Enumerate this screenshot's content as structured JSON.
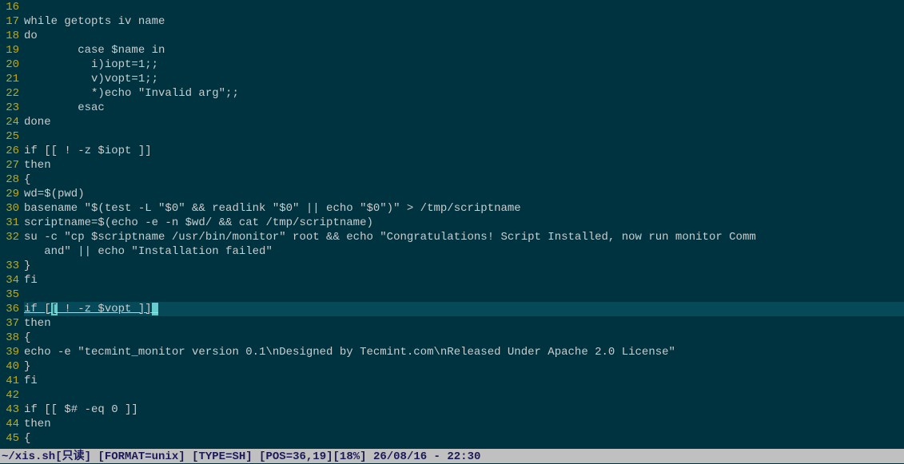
{
  "editor": {
    "lines": [
      {
        "num": 16,
        "text": ""
      },
      {
        "num": 17,
        "text": "while getopts iv name"
      },
      {
        "num": 18,
        "text": "do"
      },
      {
        "num": 19,
        "text": "        case $name in"
      },
      {
        "num": 20,
        "text": "          i)iopt=1;;"
      },
      {
        "num": 21,
        "text": "          v)vopt=1;;"
      },
      {
        "num": 22,
        "text": "          *)echo \"Invalid arg\";;"
      },
      {
        "num": 23,
        "text": "        esac"
      },
      {
        "num": 24,
        "text": "done"
      },
      {
        "num": 25,
        "text": ""
      },
      {
        "num": 26,
        "text": "if [[ ! -z $iopt ]]"
      },
      {
        "num": 27,
        "text": "then"
      },
      {
        "num": 28,
        "text": "{"
      },
      {
        "num": 29,
        "text": "wd=$(pwd)"
      },
      {
        "num": 30,
        "text": "basename \"$(test -L \"$0\" && readlink \"$0\" || echo \"$0\")\" > /tmp/scriptname"
      },
      {
        "num": 31,
        "text": "scriptname=$(echo -e -n $wd/ && cat /tmp/scriptname)"
      },
      {
        "num": 32,
        "text": "su -c \"cp $scriptname /usr/bin/monitor\" root && echo \"Congratulations! Script Installed, now run monitor Comm"
      },
      {
        "num": "",
        "text": "   and\" || echo \"Installation failed\""
      },
      {
        "num": 33,
        "text": "}"
      },
      {
        "num": 34,
        "text": "fi"
      },
      {
        "num": 35,
        "text": ""
      },
      {
        "num": 36,
        "text": "if [[ ! -z $vopt ]]",
        "cursor": true,
        "cursor_col": 4
      },
      {
        "num": 37,
        "text": "then"
      },
      {
        "num": 38,
        "text": "{"
      },
      {
        "num": 39,
        "text": "echo -e \"tecmint_monitor version 0.1\\nDesigned by Tecmint.com\\nReleased Under Apache 2.0 License\""
      },
      {
        "num": 40,
        "text": "}"
      },
      {
        "num": 41,
        "text": "fi"
      },
      {
        "num": 42,
        "text": ""
      },
      {
        "num": 43,
        "text": "if [[ $# -eq 0 ]]"
      },
      {
        "num": 44,
        "text": "then"
      },
      {
        "num": 45,
        "text": "{"
      }
    ]
  },
  "status": {
    "file": "~/xis.sh",
    "readonly": "[只读]",
    "format": "[FORMAT=unix]",
    "type": "[TYPE=SH]",
    "pos": "[POS=36,19]",
    "percent": "[18%]",
    "date": "26/08/16",
    "time": "22:30"
  }
}
